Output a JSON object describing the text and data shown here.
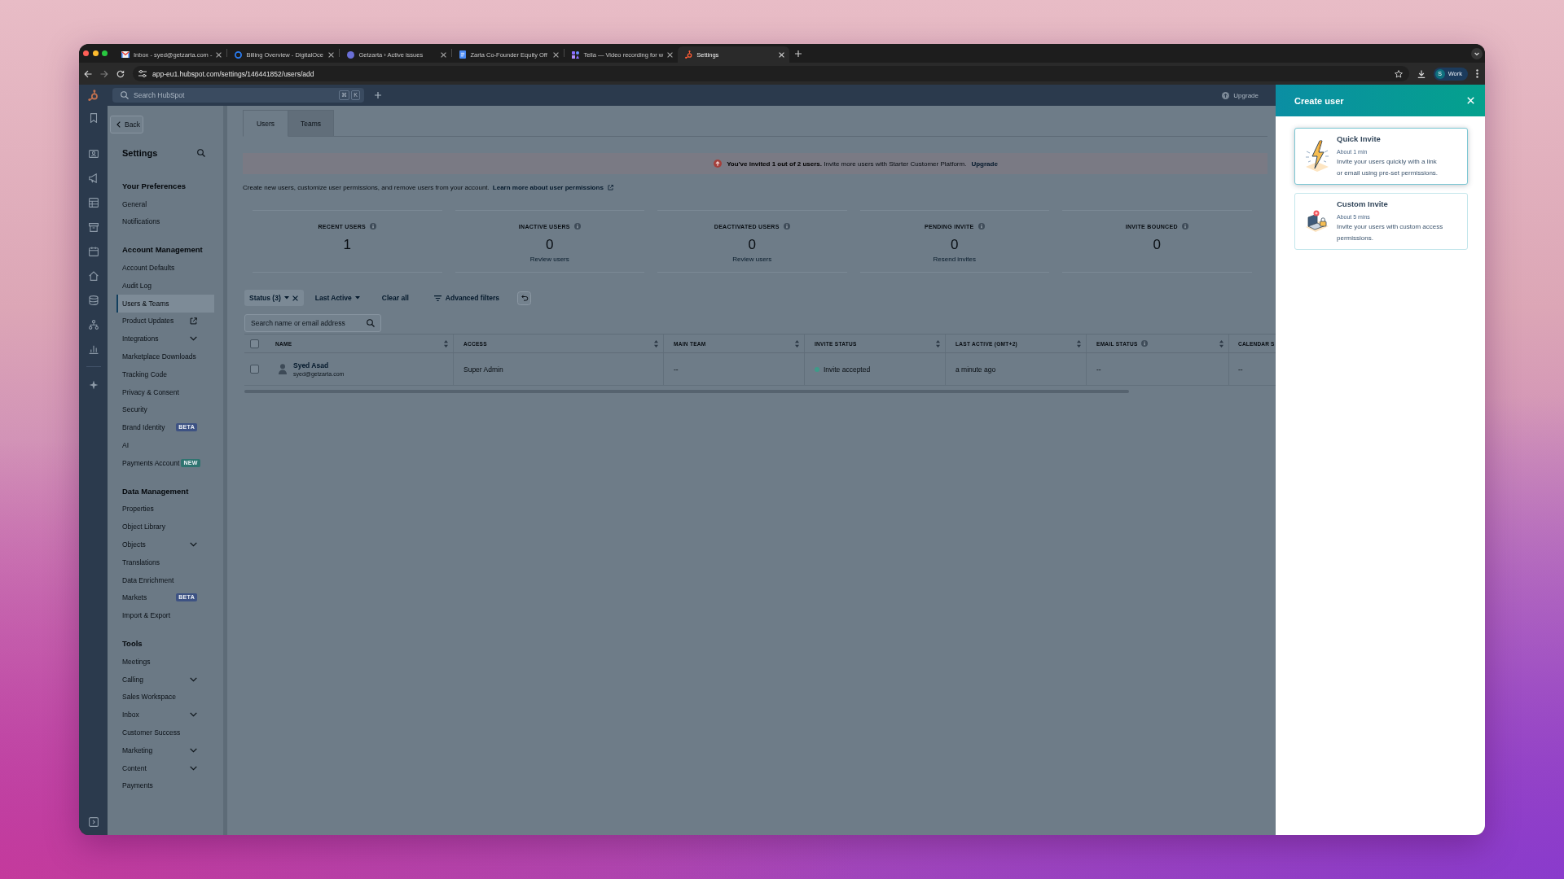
{
  "browser": {
    "tabs": [
      {
        "title": "Inbox - syed@getzarta.com -",
        "selected": false
      },
      {
        "title": "Billing Overview - DigitalOce",
        "selected": false
      },
      {
        "title": "Getzarta › Active issues",
        "selected": false
      },
      {
        "title": "Zarta Co-Founder Equity Off",
        "selected": false
      },
      {
        "title": "Tella — Video recording for w",
        "selected": false
      },
      {
        "title": "Settings",
        "selected": true
      }
    ],
    "url": "app-eu1.hubspot.com/settings/146441852/users/add",
    "profile": {
      "initial": "S",
      "label": "Work"
    }
  },
  "top_bar": {
    "search": {
      "placeholder": "Search HubSpot",
      "keys": [
        "⌘",
        "K"
      ]
    },
    "upgrade": "Upgrade"
  },
  "sidebar": {
    "back": "Back",
    "title": "Settings",
    "sections": [
      {
        "heading": "Your Preferences",
        "items": [
          {
            "label": "General",
            "kind": "page",
            "selected": false
          },
          {
            "label": "Notifications",
            "kind": "page",
            "selected": false
          }
        ]
      },
      {
        "heading": "Account Management",
        "items": [
          {
            "label": "Account Defaults",
            "kind": "page",
            "selected": false
          },
          {
            "label": "Audit Log",
            "kind": "page",
            "selected": false
          },
          {
            "label": "Users & Teams",
            "kind": "page",
            "selected": true
          },
          {
            "label": "Product Updates",
            "kind": "external",
            "selected": false
          },
          {
            "label": "Integrations",
            "kind": "group",
            "selected": false
          },
          {
            "label": "Marketplace Downloads",
            "kind": "page",
            "selected": false
          },
          {
            "label": "Tracking Code",
            "kind": "page",
            "selected": false
          },
          {
            "label": "Privacy & Consent",
            "kind": "page",
            "selected": false
          },
          {
            "label": "Security",
            "kind": "page",
            "selected": false
          },
          {
            "label": "Brand Identity",
            "kind": "page",
            "selected": false,
            "badge": {
              "text": "BETA",
              "color": "#3d5283"
            }
          },
          {
            "label": "AI",
            "kind": "page",
            "selected": false
          },
          {
            "label": "Payments Account",
            "kind": "page",
            "selected": false,
            "badge": {
              "text": "NEW",
              "color": "#2f7470"
            }
          }
        ]
      },
      {
        "heading": "Data Management",
        "items": [
          {
            "label": "Properties",
            "kind": "page",
            "selected": false
          },
          {
            "label": "Object Library",
            "kind": "page",
            "selected": false
          },
          {
            "label": "Objects",
            "kind": "group",
            "selected": false
          },
          {
            "label": "Translations",
            "kind": "page",
            "selected": false
          },
          {
            "label": "Data Enrichment",
            "kind": "page",
            "selected": false
          },
          {
            "label": "Markets",
            "kind": "page",
            "selected": false,
            "badge": {
              "text": "BETA",
              "color": "#3d5283"
            }
          },
          {
            "label": "Import & Export",
            "kind": "page",
            "selected": false
          }
        ]
      },
      {
        "heading": "Tools",
        "items": [
          {
            "label": "Meetings",
            "kind": "page",
            "selected": false
          },
          {
            "label": "Calling",
            "kind": "group",
            "selected": false
          },
          {
            "label": "Sales Workspace",
            "kind": "page",
            "selected": false
          },
          {
            "label": "Inbox",
            "kind": "group",
            "selected": false
          },
          {
            "label": "Customer Success",
            "kind": "page",
            "selected": false
          },
          {
            "label": "Marketing",
            "kind": "group",
            "selected": false
          },
          {
            "label": "Content",
            "kind": "group",
            "selected": false
          },
          {
            "label": "Payments",
            "kind": "page",
            "selected": false
          }
        ]
      }
    ]
  },
  "main": {
    "tabs": [
      {
        "label": "Users",
        "selected": true
      },
      {
        "label": "Teams",
        "selected": false
      }
    ],
    "banner": {
      "text": "**You've invited 1 out of 2 users.** Invite more users with Starter Customer Platform.",
      "link": "Upgrade"
    },
    "intro": {
      "text": "Create new users, customize user permissions, and remove users from your account.",
      "link": "Learn more about user permissions"
    },
    "stats": [
      {
        "label": "RECENT USERS",
        "value": "1"
      },
      {
        "label": "INACTIVE USERS",
        "value": "0",
        "action": "Review users"
      },
      {
        "label": "DEACTIVATED USERS",
        "value": "0",
        "action": "Review users"
      },
      {
        "label": "PENDING INVITE",
        "value": "0",
        "action": "Resend invites"
      },
      {
        "label": "INVITE BOUNCED",
        "value": "0"
      }
    ],
    "filters": [
      {
        "label": "Status (3)",
        "kind": "applied"
      },
      {
        "label": "Last Active",
        "kind": "dropdown"
      },
      {
        "label": "Clear all",
        "kind": "link"
      },
      {
        "label": "Advanced filters",
        "kind": "advanced"
      }
    ],
    "search": {
      "placeholder": "Search name or email address"
    },
    "table": {
      "all_checked": false,
      "columns": [
        {
          "label": "NAME",
          "sortable": true,
          "info": false
        },
        {
          "label": "ACCESS",
          "sortable": true,
          "info": false
        },
        {
          "label": "MAIN TEAM",
          "sortable": true,
          "info": false
        },
        {
          "label": "INVITE STATUS",
          "sortable": true,
          "info": false
        },
        {
          "label": "LAST ACTIVE (GMT+2)",
          "sortable": true,
          "info": false
        },
        {
          "label": "EMAIL STATUS",
          "sortable": true,
          "info": true
        },
        {
          "label": "CALENDAR S"
        }
      ],
      "rows": [
        {
          "checked": false,
          "cells": [
            {
              "kind": "user",
              "text": "Syed Asad",
              "detail": "syed@getzarta.com"
            },
            {
              "kind": "text",
              "text": "Super Admin"
            },
            {
              "kind": "text",
              "text": "--"
            },
            {
              "kind": "status",
              "text": "Invite accepted",
              "color": "#3e9b89"
            },
            {
              "kind": "text",
              "text": "a minute ago"
            },
            {
              "kind": "text",
              "text": "--"
            },
            {
              "kind": "text",
              "text": "--"
            }
          ]
        }
      ]
    }
  },
  "panel": {
    "title": "Create user",
    "options": [
      {
        "title": "Quick Invite",
        "duration": "About 1 min",
        "description": "Invite your users quickly with a link or email using pre-set permissions.",
        "hovered": true
      },
      {
        "title": "Custom Invite",
        "duration": "About 5 mins",
        "description": "Invite your users with custom access permissions.",
        "hovered": false
      }
    ]
  }
}
